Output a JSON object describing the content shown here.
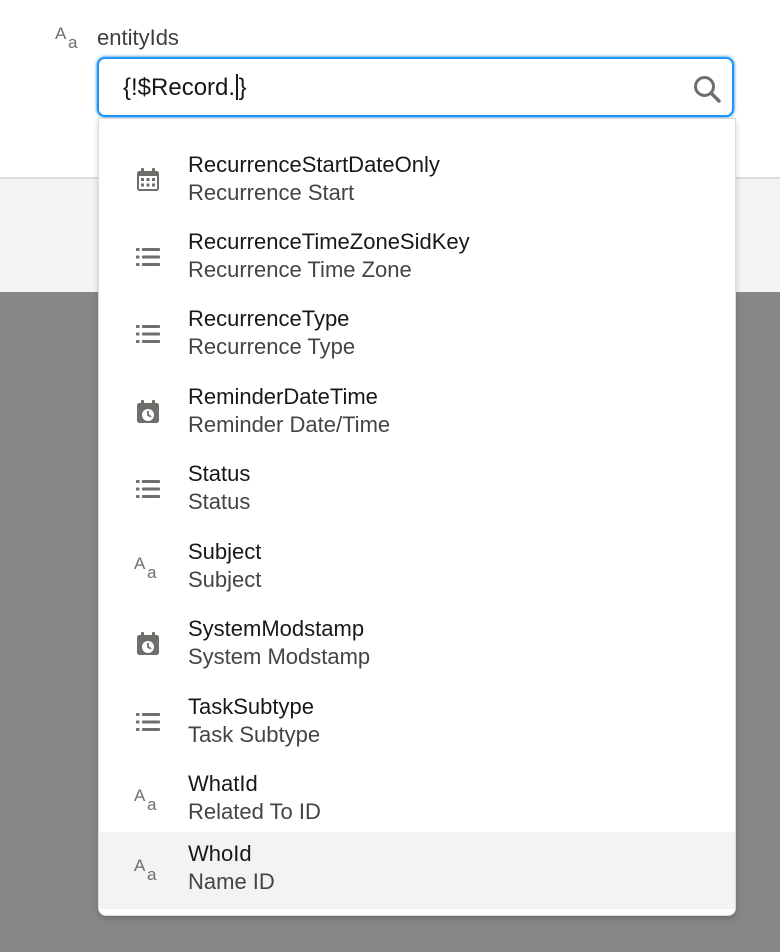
{
  "field": {
    "label": "entityIds",
    "type_icon": "text-type-icon",
    "input_value_before_caret": "{!$Record.",
    "input_value_after_caret": "}"
  },
  "search": {
    "icon": "search-icon"
  },
  "dropdown": {
    "options": [
      {
        "name": "RecurrenceStartDateOnly",
        "label": "Recurrence Start",
        "icon": "calendar-icon"
      },
      {
        "name": "RecurrenceTimeZoneSidKey",
        "label": "Recurrence Time Zone",
        "icon": "picklist-icon"
      },
      {
        "name": "RecurrenceType",
        "label": "Recurrence Type",
        "icon": "picklist-icon"
      },
      {
        "name": "ReminderDateTime",
        "label": "Reminder Date/Time",
        "icon": "datetime-icon"
      },
      {
        "name": "Status",
        "label": "Status",
        "icon": "picklist-icon"
      },
      {
        "name": "Subject",
        "label": "Subject",
        "icon": "text-type-icon"
      },
      {
        "name": "SystemModstamp",
        "label": "System Modstamp",
        "icon": "datetime-icon"
      },
      {
        "name": "TaskSubtype",
        "label": "Task Subtype",
        "icon": "picklist-icon"
      },
      {
        "name": "WhatId",
        "label": "Related To ID",
        "icon": "text-type-icon"
      },
      {
        "name": "WhoId",
        "label": "Name ID",
        "icon": "text-type-icon",
        "hovered": true
      }
    ]
  },
  "colors": {
    "focus_border": "#1b96ff",
    "icon_gray": "#706e6b",
    "hover_bg": "#f3f3f3",
    "overlay": "#878787"
  }
}
